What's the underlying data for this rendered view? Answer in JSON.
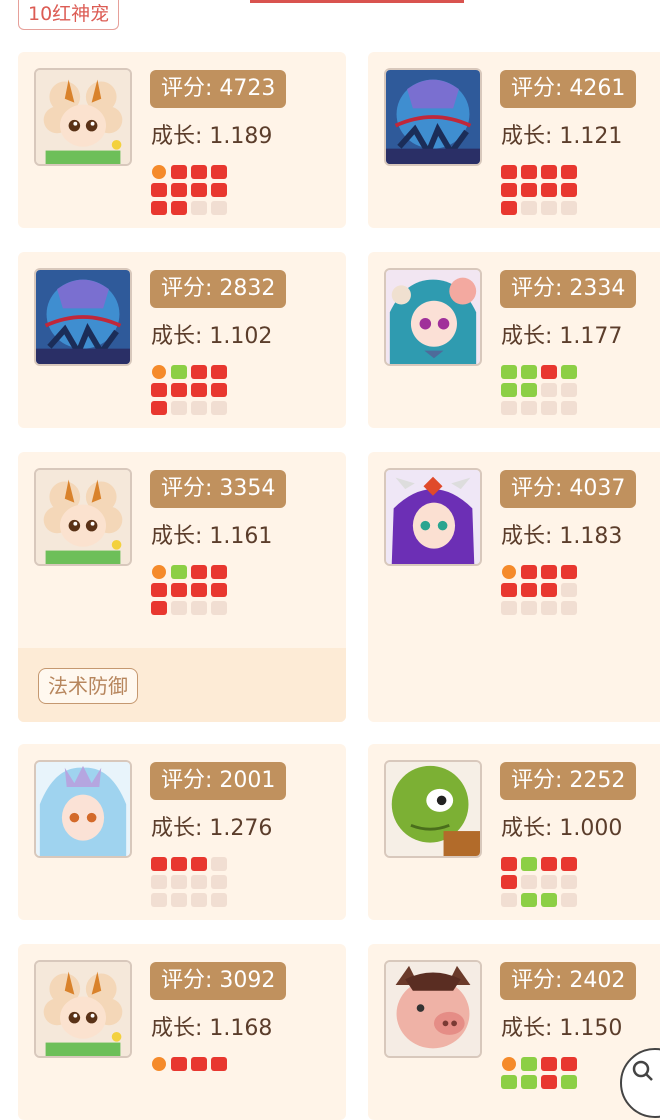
{
  "header": {
    "category_tag": "10红神宠"
  },
  "colors": {
    "score_bg": "#c0915e",
    "card_bg": "#fff4e8",
    "dot_red": "#e8372f",
    "dot_green": "#8ccf45",
    "dot_orange": "#f58a2a",
    "dot_empty": "#f1ded2"
  },
  "pets": [
    {
      "avatar": "sheep-pet-icon",
      "score": "评分: 4723",
      "growth": "成长: 1.189",
      "dots": [
        "o",
        "r",
        "r",
        "r",
        "r",
        "r",
        "r",
        "r",
        "r",
        "r",
        "e",
        "e"
      ]
    },
    {
      "avatar": "armored-pet-icon",
      "score": "评分: 4261",
      "growth": "成长: 1.121",
      "dots": [
        "r",
        "r",
        "r",
        "r",
        "r",
        "r",
        "r",
        "r",
        "r",
        "e",
        "e",
        "e"
      ]
    },
    {
      "avatar": "armored-pet-icon",
      "score": "评分: 2832",
      "growth": "成长: 1.102",
      "dots": [
        "o",
        "g",
        "r",
        "r",
        "r",
        "r",
        "r",
        "r",
        "r",
        "e",
        "e",
        "e"
      ]
    },
    {
      "avatar": "elf-pet-icon",
      "score": "评分: 2334",
      "growth": "成长: 1.177",
      "dots": [
        "g",
        "g",
        "r",
        "g",
        "g",
        "g",
        "e",
        "e",
        "e",
        "e",
        "e",
        "e"
      ]
    },
    {
      "avatar": "sheep-pet-icon",
      "score": "评分: 3354",
      "growth": "成长: 1.161",
      "dots": [
        "o",
        "g",
        "r",
        "r",
        "r",
        "r",
        "r",
        "r",
        "r",
        "e",
        "e",
        "e"
      ],
      "skill": "法术防御"
    },
    {
      "avatar": "sorceress-pet-icon",
      "score": "评分: 4037",
      "growth": "成长: 1.183",
      "dots": [
        "o",
        "r",
        "r",
        "r",
        "r",
        "r",
        "r",
        "e",
        "e",
        "e",
        "e",
        "e"
      ]
    },
    {
      "avatar": "frost-pet-icon",
      "score": "评分: 2001",
      "growth": "成长: 1.276",
      "dots": [
        "r",
        "r",
        "r",
        "e",
        "e",
        "e",
        "e",
        "e",
        "e",
        "e",
        "e",
        "e"
      ]
    },
    {
      "avatar": "turtle-pet-icon",
      "score": "评分: 2252",
      "growth": "成长: 1.000",
      "dots": [
        "r",
        "g",
        "r",
        "r",
        "r",
        "e",
        "e",
        "e",
        "e",
        "g",
        "g",
        "e"
      ]
    },
    {
      "avatar": "sheep-pet-icon",
      "score": "评分: 3092",
      "growth": "成长: 1.168",
      "dots": [
        "o",
        "r",
        "r",
        "r"
      ]
    },
    {
      "avatar": "boar-pet-icon",
      "score": "评分: 2402",
      "growth": "成长: 1.150",
      "dots": [
        "o",
        "g",
        "r",
        "r",
        "g",
        "g",
        "r",
        "g"
      ]
    }
  ]
}
